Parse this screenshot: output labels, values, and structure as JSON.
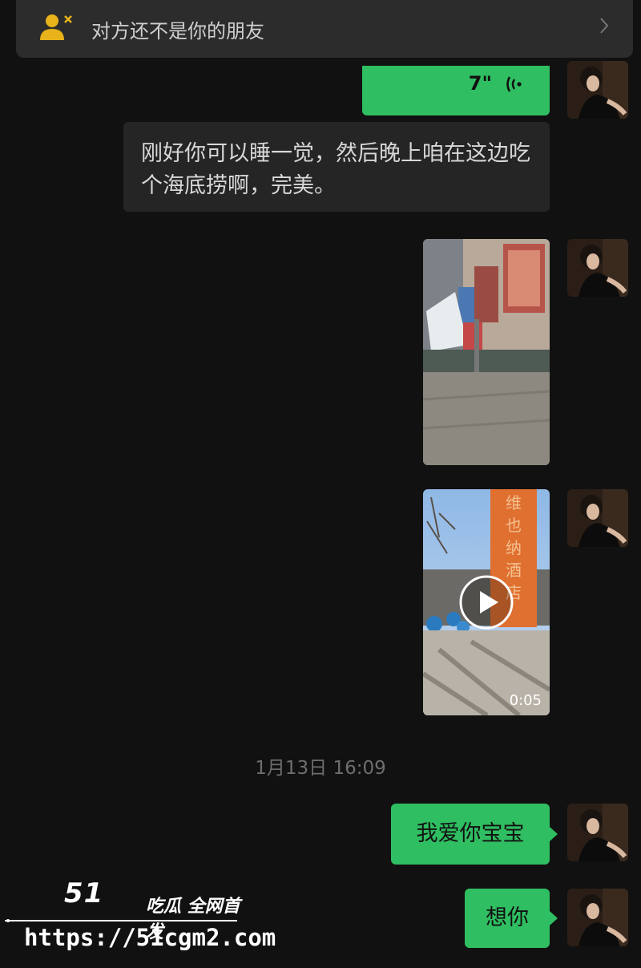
{
  "banner": {
    "text": "对方还不是你的朋友",
    "icon": "person-blocked-icon",
    "chevron_icon": "chevron-right-icon"
  },
  "messages": {
    "voice": {
      "duration": "7\"",
      "icon": "voice-wave-icon"
    },
    "received_text": "刚好你可以睡一觉，然后晚上咱在这边吃个海底捞啊，完美。",
    "image": {
      "description_icon": "photo-thumbnail"
    },
    "video": {
      "duration": "0:05",
      "sign_text": "维也纳酒店"
    },
    "timestamp": "1月13日 16:09",
    "sent_1": "我爱你宝宝",
    "sent_2": "想你"
  },
  "watermark": {
    "logo": "51",
    "tag": "吃瓜 全网首发",
    "url": "https://51cgm2.com"
  },
  "colors": {
    "background": "#111111",
    "green_bubble": "#2fbe61",
    "gray_bubble": "#252525",
    "banner": "#2c2c2c"
  }
}
